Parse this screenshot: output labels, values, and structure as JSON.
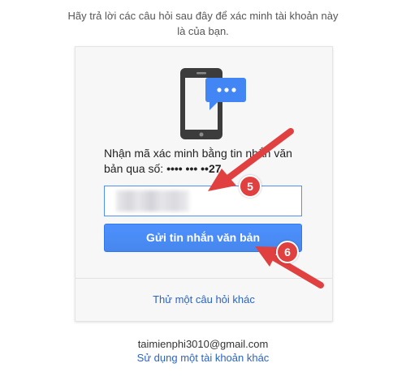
{
  "intro": {
    "line1": "Hãy trả lời các câu hỏi sau đây để xác minh tài khoản này",
    "line2": "là của bạn."
  },
  "verification": {
    "icon": "phone-sms-icon",
    "prompt": "Nhận mã xác minh bằng tin nhắn văn bản qua số:",
    "masked_number": "•••• ••• ••27",
    "code_input_value": "",
    "send_button_label": "Gửi tin nhắn văn bản",
    "try_other_link": "Thử một câu hỏi khác"
  },
  "account": {
    "email": "taimienphi3010@gmail.com",
    "switch_link": "Sử dụng một tài khoản khác"
  },
  "annotations": {
    "badge_5": "5",
    "badge_6": "6",
    "color": "#e0403f"
  },
  "colors": {
    "button": "#4d90fe",
    "link": "#2a64c5",
    "card_background": "#f7f7f7"
  }
}
